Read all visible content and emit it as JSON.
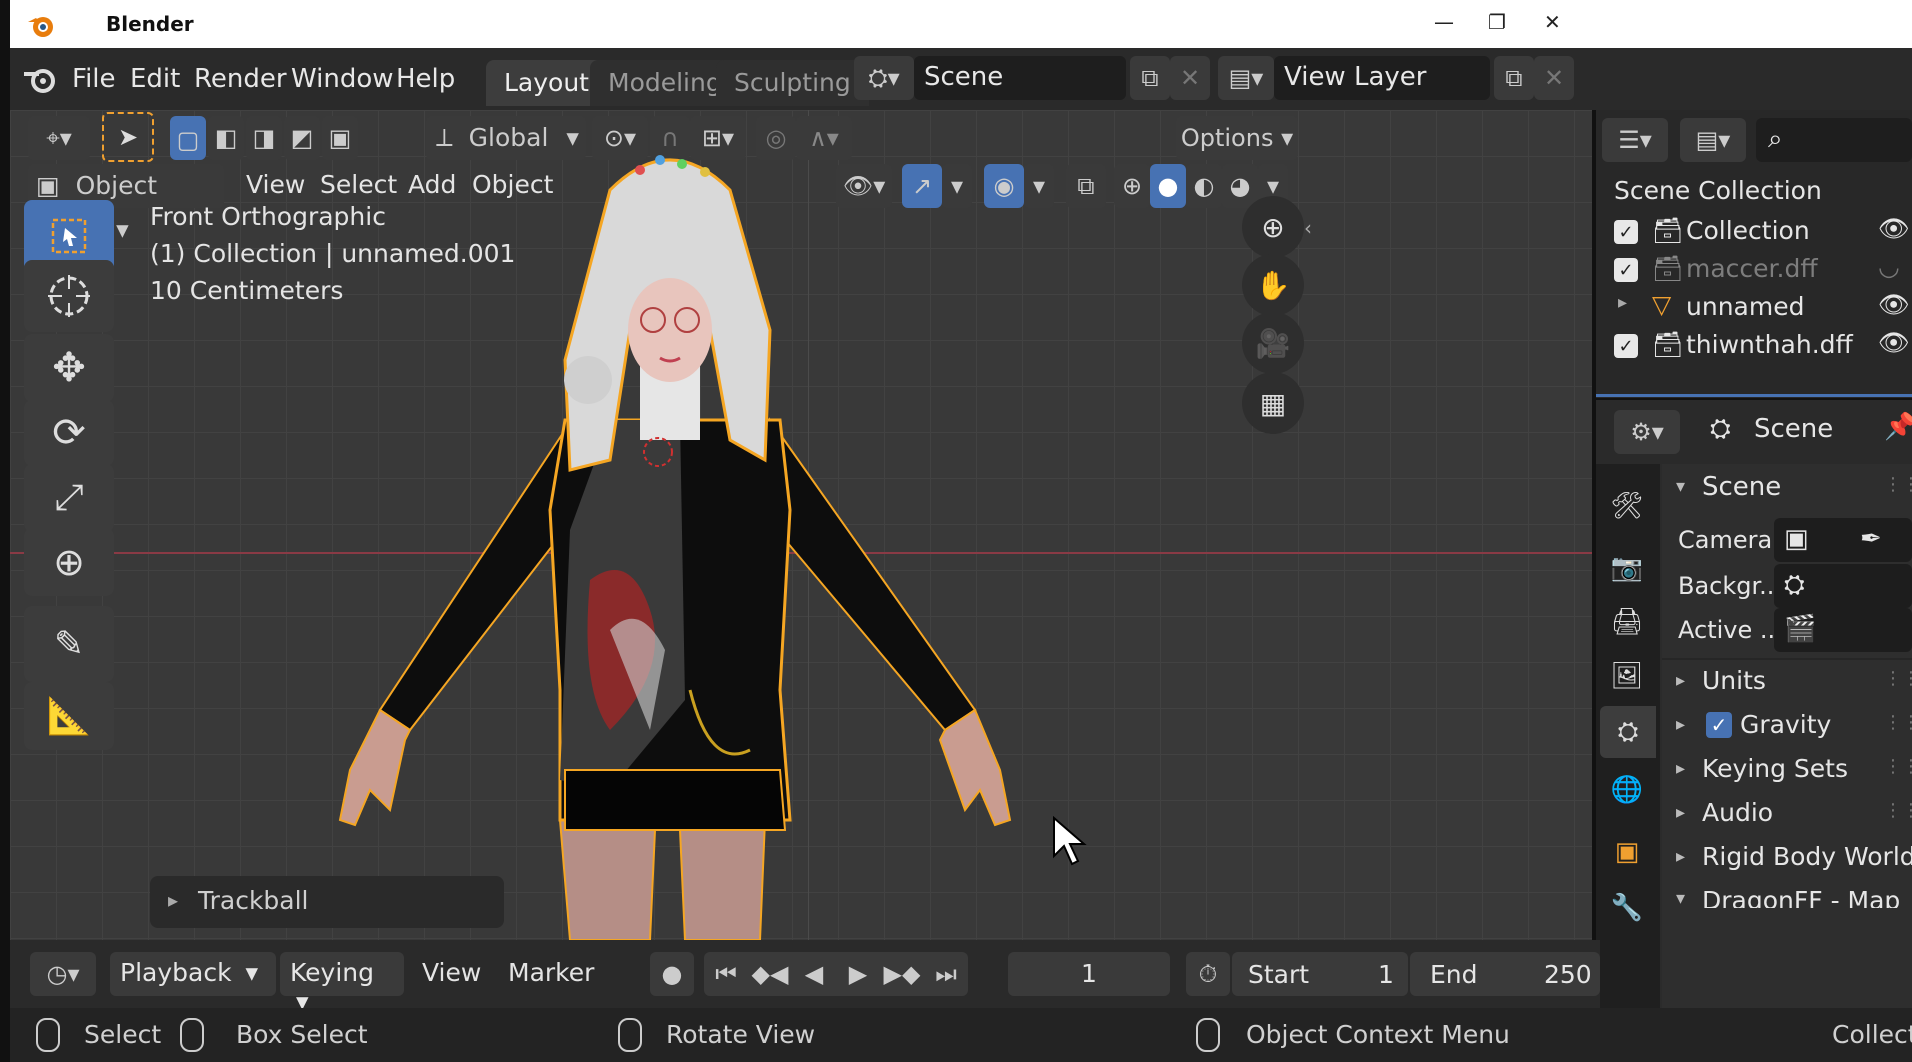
{
  "window": {
    "title": "Blender"
  },
  "menu": [
    "File",
    "Edit",
    "Render",
    "Window",
    "Help"
  ],
  "workspaces": [
    "Layout",
    "Modeling",
    "Sculpting"
  ],
  "scene_field": "Scene",
  "view_layer_field": "View Layer",
  "toolbar": {
    "transform_orientation": "Global",
    "options": "Options"
  },
  "viewport_header": {
    "mode": "Object Mode",
    "menus": [
      "View",
      "Select",
      "Add",
      "Object"
    ]
  },
  "viewport_info": {
    "view_name": "Front Orthographic",
    "collection_line": "(1) Collection | unnamed.001",
    "scale_text": "10 Centimeters"
  },
  "last_operator": "Trackball",
  "outliner": {
    "title": "Scene Collection",
    "items": [
      {
        "label": "Collection",
        "icon": "collection-icon",
        "dim": false
      },
      {
        "label": "maccer.dff",
        "icon": "collection-icon",
        "dim": true
      },
      {
        "label": "unnamed",
        "icon": "mesh-icon",
        "dim": false
      },
      {
        "label": "thiwnthah.dff",
        "icon": "collection-icon",
        "dim": false
      }
    ]
  },
  "properties": {
    "header": "Scene",
    "section": "Scene",
    "fields": [
      {
        "label": "Camera"
      },
      {
        "label": "Backgr.."
      },
      {
        "label": "Active .."
      }
    ],
    "subsections": [
      "Units",
      "Gravity",
      "Keying Sets",
      "Audio",
      "Rigid Body World",
      "DragonFF - Map"
    ]
  },
  "timeline": {
    "menus": [
      "Playback",
      "Keying",
      "View",
      "Marker"
    ],
    "current_frame": "1",
    "start_label": "Start",
    "start_value": "1",
    "end_label": "End",
    "end_value": "250"
  },
  "statusbar": {
    "select": "Select",
    "box_select": "Box Select",
    "rotate": "Rotate View",
    "context": "Object Context Menu",
    "collection": "Collection"
  },
  "colors": {
    "accent": "#4772b3",
    "selection_outline": "#f5a623",
    "bg": "#393939"
  }
}
